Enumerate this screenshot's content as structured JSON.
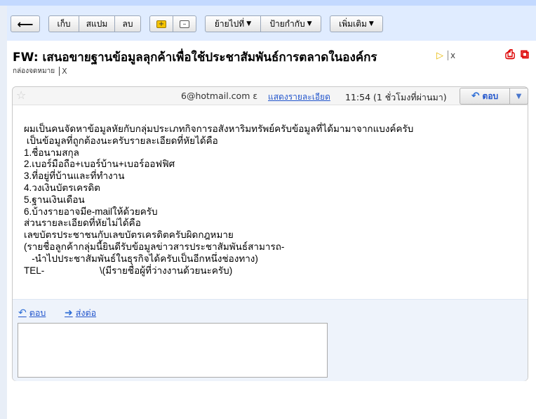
{
  "toolbar": {
    "back_label": "🡐",
    "archive_label": "เก็บ",
    "spam_label": "สแปม",
    "delete_label": "ลบ",
    "mark_icon": "label-add-icon",
    "remove_icon": "label-remove-icon",
    "move_label": "ย้ายไปที่",
    "labels_label": "ป้ายกำกับ",
    "more_label": "เพิ่มเติม"
  },
  "subject": "FW: เสนอขายฐานข้อมูลลุกค้าเพื่อใช้ประชาสัมพันธ์การตลาดในองค์กร",
  "label_tag": {
    "close": "x"
  },
  "inbox_label": {
    "name": "กล่องจดหมาย",
    "close": "X"
  },
  "message": {
    "sender": "6@hotmail.com ε",
    "details_link": "แสดงรายละเอียด",
    "time": "11:54 (1 ชั่วโมงที่ผ่านมา)",
    "reply_label": "ตอบ",
    "more_label": "▼",
    "body_lines": [
      "ผมเป็นคนจัดหาข้อมูลหัยกับกลุ่มประเภทกิจการอสังหาริมทรัพย์ครับข้อมูลที่ได้มามาจากแบงค์ครับ",
      " เป็นข้อมูลที่ถูกต้องนะครับรายละเอียดที่หัยได้คือ",
      "1.ชื่อนามสกุล",
      "2.เบอร์มือถือ+เบอร์บ้าน+เบอร์ออฟฟิศ",
      "3.ที่อยู่ที่บ้านและที่ทำงาน",
      "4.วงเงินบัตรเครดิต",
      "5.ฐานเงินเดือน",
      "6.บ้างรายอาจมีe-mailให้ด้วยครับ",
      "ส่วนรายละเอียดที่หัยไม่ได้คือ",
      "เลขบัตรประชาชนกับเลขบัตรเครดิตครับผิดกฎหมาย",
      "(รายชื่อลูกค้ากลุ่มนี้ยินดีรับข้อมูลข่าวสารประชาสัมพันธ์สามารถ-",
      "   -นำไปประชาสัมพันธ์ในธุรกิจได้ครับเป็นอีกหนึ่งช่องทาง)",
      "TEL-                     \\(มีรายชื่อผู้ที่ว่างงานด้วยนะครับ)"
    ]
  },
  "footer": {
    "reply_link": "ตอบ",
    "forward_link": "ส่งต่อ"
  }
}
